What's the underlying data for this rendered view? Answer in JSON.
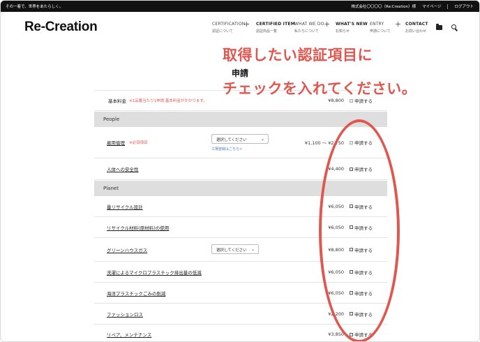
{
  "topbar": {
    "tagline": "その一着で、世界をあたらしく。",
    "company": "株式会社〇〇〇〇（Re:Creation）様",
    "mypage": "マイページ",
    "logout": "ログアウト"
  },
  "header": {
    "logo": "Re-Creation",
    "nav": [
      {
        "en": "CERTIFICATION",
        "ja": "認証について"
      },
      {
        "en": "CERTIFIED ITEM",
        "ja": "認証商品一覧"
      },
      {
        "en": "WHAT WE DO",
        "ja": "私たちについて"
      },
      {
        "en": "WHAT'S NEW",
        "ja": "お知らせ"
      },
      {
        "en": "ENTRY",
        "ja": "申請について"
      },
      {
        "en": "CONTACT",
        "ja": "お問い合わせ"
      }
    ],
    "plus": "+"
  },
  "page_title": "申請",
  "annotation": {
    "line1": "取得したい認証項目に",
    "line2": "チェックを入れてください。"
  },
  "table": {
    "base": {
      "label": "基本料金",
      "note": "※1品番当たり1申請 基本料金がかかります。",
      "price": "¥8,800",
      "apply": "申請する"
    },
    "sections": [
      {
        "name": "People",
        "rows": [
          {
            "label": "雇用倫理",
            "required": "※必須項目",
            "select": "選択してください",
            "sublink": "工場登録はこちら>",
            "price": "¥1,100 〜 ¥2,750",
            "apply": "申請する"
          },
          {
            "label": "人体への安全性",
            "price": "¥4,400",
            "apply": "申請する"
          }
        ]
      },
      {
        "name": "Planet",
        "rows": [
          {
            "label": "量リサイクル設計",
            "price": "¥6,050",
            "apply": "申請する"
          },
          {
            "label": "リサイクル材料(原材料)の使用",
            "price": "¥6,050",
            "apply": "申請する"
          },
          {
            "label": "グリーンハウスガス",
            "select": "選択してください",
            "price": "¥8,800",
            "apply": "申請する"
          },
          {
            "label": "洗濯によるマイクロプラスチック排出量の低減",
            "price": "¥6,050",
            "apply": "申請する"
          },
          {
            "label": "海洋プラスチックごみの削減",
            "price": "¥6,050",
            "apply": "申請する"
          },
          {
            "label": "ファッションロス",
            "price": "¥2,200",
            "apply": "申請する"
          },
          {
            "label": "リペア、メンテナンス",
            "price": "¥3,850",
            "apply": "申請する"
          }
        ]
      }
    ]
  },
  "colors": {
    "annotation": "#e0574f",
    "link": "#4a7cc0",
    "section_bg": "#dedede"
  }
}
